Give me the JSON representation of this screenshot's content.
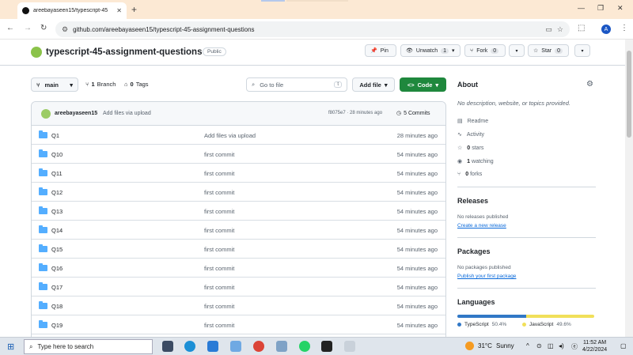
{
  "browser": {
    "tab_title": "areebayaseen15/typescript-45",
    "url": "github.com/areebayaseen15/typescript-45-assignment-questions",
    "profile_initial": "A"
  },
  "repo": {
    "name": "typescript-45-assignment-questions",
    "visibility": "Public",
    "pin_label": "Pin",
    "unwatch_label": "Unwatch",
    "unwatch_count": "1",
    "fork_label": "Fork",
    "fork_count": "0",
    "star_label": "Star",
    "star_count": "0"
  },
  "toolbar": {
    "branch": "main",
    "branches_count": "1",
    "branches_label": "Branch",
    "tags_count": "0",
    "tags_label": "Tags",
    "goto_placeholder": "Go to file",
    "goto_kbd": "t",
    "add_file_label": "Add file",
    "code_label": "Code"
  },
  "latest_commit": {
    "user": "areebayaseen15",
    "message": "Add files via upload",
    "hash_time": "f8075e7 · 28 minutes ago",
    "commits_label": "5 Commits"
  },
  "files": [
    {
      "name": "Q1",
      "message": "Add files via upload",
      "time": "28 minutes ago"
    },
    {
      "name": "Q10",
      "message": "first commit",
      "time": "54 minutes ago"
    },
    {
      "name": "Q11",
      "message": "first commit",
      "time": "54 minutes ago"
    },
    {
      "name": "Q12",
      "message": "first commit",
      "time": "54 minutes ago"
    },
    {
      "name": "Q13",
      "message": "first commit",
      "time": "54 minutes ago"
    },
    {
      "name": "Q14",
      "message": "first commit",
      "time": "54 minutes ago"
    },
    {
      "name": "Q15",
      "message": "first commit",
      "time": "54 minutes ago"
    },
    {
      "name": "Q16",
      "message": "first commit",
      "time": "54 minutes ago"
    },
    {
      "name": "Q17",
      "message": "first commit",
      "time": "54 minutes ago"
    },
    {
      "name": "Q18",
      "message": "first commit",
      "time": "54 minutes ago"
    },
    {
      "name": "Q19",
      "message": "first commit",
      "time": "54 minutes ago"
    }
  ],
  "about": {
    "title": "About",
    "description": "No description, website, or topics provided.",
    "readme": "Readme",
    "activity": "Activity",
    "stars_count": "0",
    "stars_label": "stars",
    "watching_count": "1",
    "watching_label": "watching",
    "forks_count": "0",
    "forks_label": "forks"
  },
  "releases": {
    "title": "Releases",
    "text": "No releases published",
    "link": "Create a new release"
  },
  "packages": {
    "title": "Packages",
    "text": "No packages published",
    "link": "Publish your first package"
  },
  "languages": {
    "title": "Languages",
    "items": [
      {
        "name": "TypeScript",
        "percent": "50.4%",
        "color": "#3178c6",
        "share": 50.4
      },
      {
        "name": "JavaScript",
        "percent": "49.6%",
        "color": "#f1e05a",
        "share": 49.6
      }
    ]
  },
  "taskbar": {
    "search_placeholder": "Type here to search",
    "weather_temp": "31°C",
    "weather_text": "Sunny",
    "time": "11:52 AM",
    "date": "4/22/2024"
  }
}
